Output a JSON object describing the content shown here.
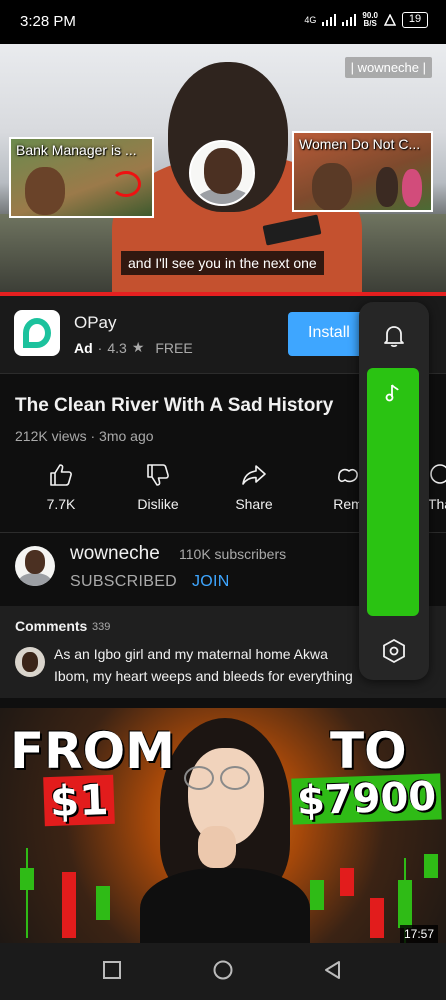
{
  "status_bar": {
    "time": "3:28 PM",
    "network": "4G",
    "speed_value": "90.0",
    "speed_unit": "B/S",
    "battery": "19"
  },
  "video": {
    "watermark": "| wowneche |",
    "caption": "and I'll see you in the next one",
    "endcards": [
      {
        "title": "Bank Manager is ..."
      },
      {
        "title": "Women Do Not C..."
      }
    ]
  },
  "ad": {
    "app_name": "OPay",
    "tag": "Ad",
    "rating": "4.3",
    "price": "FREE",
    "install_label": "Install",
    "brand_color": "#1cc29d"
  },
  "video_info": {
    "title": "The Clean River With A Sad History",
    "meta": "212K views · 3mo ago"
  },
  "actions": [
    {
      "label": "7.7K",
      "icon": "like-icon"
    },
    {
      "label": "Dislike",
      "icon": "dislike-icon"
    },
    {
      "label": "Share",
      "icon": "share-icon"
    },
    {
      "label": "Rem",
      "icon": "remix-icon"
    },
    {
      "label": "Tha",
      "icon": "thanks-icon"
    }
  ],
  "channel": {
    "name": "wowneche",
    "subscribers": "110K subscribers",
    "subscribed_label": "SUBSCRIBED",
    "join_label": "JOIN"
  },
  "comments": {
    "title": "Comments",
    "count": "339",
    "top_comment": "As an Igbo girl and my maternal home Akwa Ibom, my heart weeps and bleeds for everything my a"
  },
  "next_video": {
    "from_text": "FROM",
    "from_amount": "$1",
    "to_text": "TO",
    "to_amount": "$7900",
    "duration": "17:57"
  },
  "floating_panel": {
    "accent_color": "#2ac312"
  },
  "colors": {
    "progress": "#e52020",
    "link": "#3ea6ff",
    "background": "#0f0f0f"
  }
}
